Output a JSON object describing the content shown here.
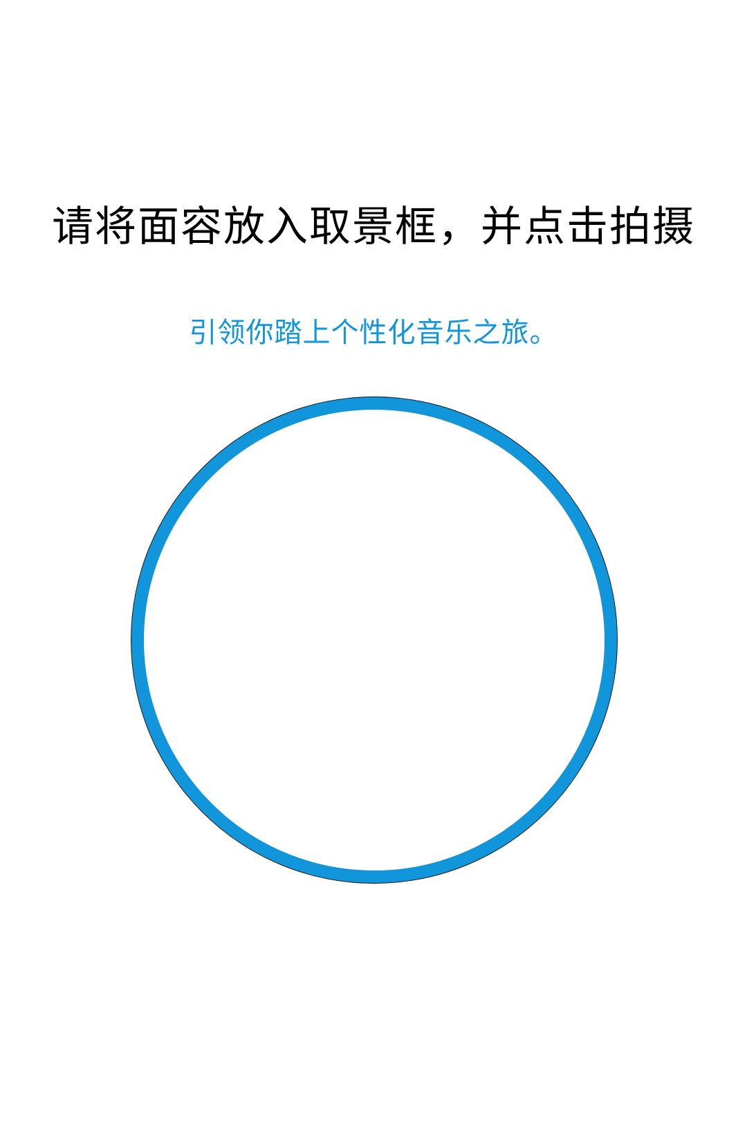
{
  "header": {
    "title": "请将面容放入取景框，并点击拍摄",
    "subtitle": "引领你踏上个性化音乐之旅。"
  },
  "camera": {
    "frame_shape": "circle",
    "accent_color": "#1296db"
  }
}
